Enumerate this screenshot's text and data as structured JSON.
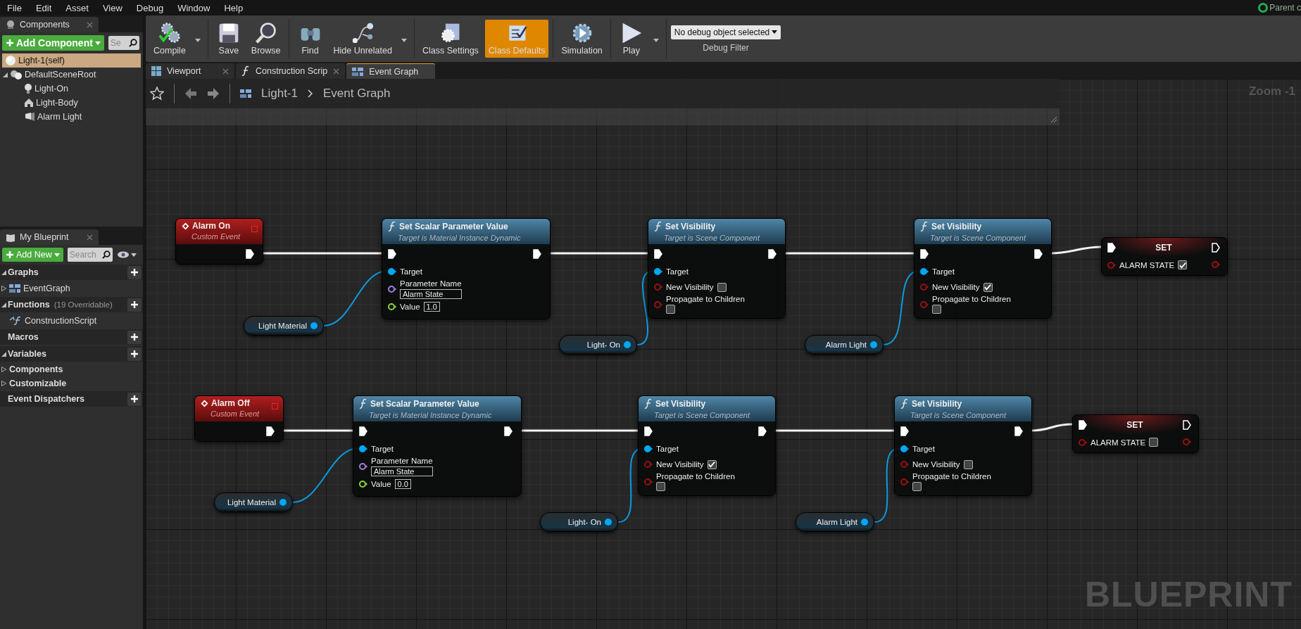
{
  "menu": [
    "File",
    "Edit",
    "Asset",
    "View",
    "Debug",
    "Window",
    "Help"
  ],
  "corner": {
    "label": "Parent c"
  },
  "components_panel": {
    "tab": "Components",
    "add_button": "Add Component",
    "search_placeholder": "Se",
    "tree": [
      {
        "label": "Light-1(self)",
        "kind": "actor",
        "selected": true
      },
      {
        "label": "DefaultSceneRoot",
        "kind": "scene",
        "selected": false,
        "expanded": true,
        "children": [
          {
            "label": "Light-On",
            "kind": "bulb",
            "selected": false
          },
          {
            "label": "Light-Body",
            "kind": "mesh",
            "selected": false
          },
          {
            "label": "Alarm Light",
            "kind": "spot",
            "selected": false
          }
        ]
      }
    ]
  },
  "my_blueprint": {
    "tab": "My Blueprint",
    "add_button": "Add New",
    "search_placeholder": "Search",
    "sections": [
      {
        "title": "Graphs",
        "expanded": true,
        "items": [
          {
            "label": "EventGraph",
            "kind": "graph",
            "expanded": false
          }
        ]
      },
      {
        "title": "Functions",
        "note": "(19 Overridable)",
        "expanded": true,
        "items": [
          {
            "label": "ConstructionScript",
            "kind": "function"
          }
        ]
      },
      {
        "title": "Macros"
      },
      {
        "title": "Variables",
        "expanded": true,
        "items": [
          {
            "label": "Components",
            "kind": "category",
            "expanded": false
          },
          {
            "label": "Customizable",
            "kind": "category",
            "expanded": false
          }
        ]
      },
      {
        "title": "Event Dispatchers"
      }
    ]
  },
  "toolbar": {
    "groups": [
      [
        {
          "label": "Compile",
          "kind": "compile",
          "dropdown": true,
          "selected": false
        }
      ],
      [
        {
          "label": "Save",
          "kind": "save",
          "selected": false
        },
        {
          "label": "Browse",
          "kind": "browse",
          "selected": false
        }
      ],
      [
        {
          "label": "Find",
          "kind": "find",
          "selected": false
        },
        {
          "label": "Hide Unrelated",
          "kind": "hide",
          "dropdown": true,
          "selected": false
        }
      ],
      [
        {
          "label": "Class Settings",
          "kind": "settings",
          "selected": false
        },
        {
          "label": "Class Defaults",
          "kind": "defaults",
          "selected": true
        }
      ],
      [
        {
          "label": "Simulation",
          "kind": "simulation",
          "selected": false
        }
      ],
      [
        {
          "label": "Play",
          "kind": "play",
          "dropdown": true,
          "selected": false
        }
      ]
    ],
    "debug": {
      "value": "No debug object selected",
      "label": "Debug Filter"
    }
  },
  "tabs": [
    {
      "label": "Viewport",
      "kind": "viewport",
      "selected": false,
      "closable": true
    },
    {
      "label": "Construction Scrip",
      "kind": "function",
      "selected": false,
      "closable": true
    },
    {
      "label": "Event Graph",
      "kind": "graph",
      "selected": true,
      "closable": false
    }
  ],
  "breadcrumb": {
    "path": [
      "Light-1",
      "Event Graph"
    ]
  },
  "graph": {
    "zoom": "Zoom -1",
    "label": "BLUEPRINT",
    "rows": [
      {
        "nodes": [
          {
            "kind": "event",
            "title": "Alarm On",
            "subtitle": "Custom Event"
          },
          {
            "kind": "variable",
            "label": "Light Material"
          },
          {
            "kind": "function",
            "title": "Set Scalar Parameter Value",
            "subtitle": "Target is Material Instance Dynamic",
            "pins": [
              {
                "kind": "object",
                "label": "Target"
              },
              {
                "kind": "name",
                "label": "Parameter Name",
                "value": "Alarm State"
              },
              {
                "kind": "float",
                "label": "Value",
                "value": "1.0"
              }
            ]
          },
          {
            "kind": "variable",
            "label": "Light- On"
          },
          {
            "kind": "function",
            "title": "Set Visibility",
            "subtitle": "Target is Scene Component",
            "pins": [
              {
                "kind": "object",
                "label": "Target"
              },
              {
                "kind": "bool",
                "label": "New Visibility",
                "checked": false
              },
              {
                "kind": "bool",
                "label": "Propagate to Children",
                "checked": false
              }
            ]
          },
          {
            "kind": "variable",
            "label": "Alarm Light"
          },
          {
            "kind": "function",
            "title": "Set Visibility",
            "subtitle": "Target is Scene Component",
            "pins": [
              {
                "kind": "object",
                "label": "Target"
              },
              {
                "kind": "bool",
                "label": "New Visibility",
                "checked": true
              },
              {
                "kind": "bool",
                "label": "Propagate to Children",
                "checked": false
              }
            ]
          },
          {
            "kind": "set",
            "title": "SET",
            "pins": [
              {
                "kind": "bool",
                "label": "ALARM STATE",
                "checked": true
              }
            ]
          }
        ]
      },
      {
        "nodes": [
          {
            "kind": "event",
            "title": "Alarm Off",
            "subtitle": "Custom Event"
          },
          {
            "kind": "variable",
            "label": "Light Material"
          },
          {
            "kind": "function",
            "title": "Set Scalar Parameter Value",
            "subtitle": "Target is Material Instance Dynamic",
            "pins": [
              {
                "kind": "object",
                "label": "Target"
              },
              {
                "kind": "name",
                "label": "Parameter Name",
                "value": "Alarm State"
              },
              {
                "kind": "float",
                "label": "Value",
                "value": "0.0"
              }
            ]
          },
          {
            "kind": "variable",
            "label": "Light- On"
          },
          {
            "kind": "function",
            "title": "Set Visibility",
            "subtitle": "Target is Scene Component",
            "pins": [
              {
                "kind": "object",
                "label": "Target"
              },
              {
                "kind": "bool",
                "label": "New Visibility",
                "checked": true
              },
              {
                "kind": "bool",
                "label": "Propagate to Children",
                "checked": false
              }
            ]
          },
          {
            "kind": "variable",
            "label": "Alarm Light"
          },
          {
            "kind": "function",
            "title": "Set Visibility",
            "subtitle": "Target is Scene Component",
            "pins": [
              {
                "kind": "object",
                "label": "Target"
              },
              {
                "kind": "bool",
                "label": "New Visibility",
                "checked": false
              },
              {
                "kind": "bool",
                "label": "Propagate to Children",
                "checked": false
              }
            ]
          },
          {
            "kind": "set",
            "title": "SET",
            "pins": [
              {
                "kind": "bool",
                "label": "ALARM STATE",
                "checked": false
              }
            ]
          }
        ]
      }
    ]
  }
}
